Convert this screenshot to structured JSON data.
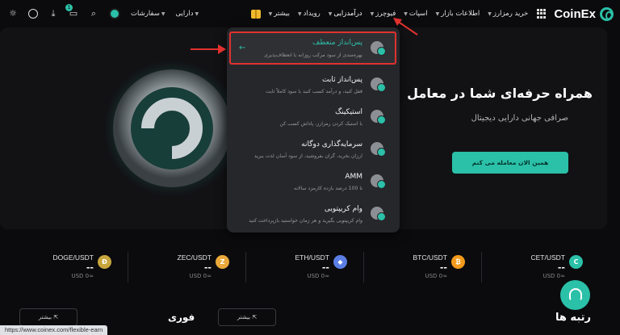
{
  "nav": {
    "brand": "CoinEx",
    "items": [
      {
        "label": "خرید رمزارز",
        "caret": true
      },
      {
        "label": "اطلاعات بازار",
        "caret": true
      },
      {
        "label": "اسپات",
        "caret": true
      },
      {
        "label": "فیوچرز",
        "caret": true
      },
      {
        "label": "درآمدزایی",
        "caret": true
      },
      {
        "label": "رویداد",
        "caret": true
      },
      {
        "label": "بیشتر",
        "caret": true
      }
    ],
    "assets": "دارایی",
    "orders": "سفارشات",
    "notification_count": "1"
  },
  "hero": {
    "title": "همراه حرفه‌ای شما در معامل",
    "subtitle": "صرافی جهانی دارایی دیجیتال",
    "cta": "همین الان معامله می کنم"
  },
  "dropdown": {
    "items": [
      {
        "title": "پس‌انداز منعطف",
        "desc": "بهره‌مندی از سود مرکب روزانه با انعطاف‌پذیری",
        "highlighted": true
      },
      {
        "title": "پس‌انداز ثابت",
        "desc": "قفل کنید، و درآمد کسب کنید با سود کاملاً ثابت"
      },
      {
        "title": "استیکینگ",
        "desc": "با استیک کردن رمزارز، پاداش کسب کن"
      },
      {
        "title": "سرمایه‌گذاری دوگانه",
        "desc": "ارزان بخرید، گران بفروشید، از سود آسان لذت ببرید"
      },
      {
        "title": "AMM",
        "desc": "تا 100 درصد بازده کارمزد سالانه"
      },
      {
        "title": "وام کریپتویی",
        "desc": "وام کریپتویی بگیرید و هر زمان خواستید بازپرداخت کنید"
      }
    ]
  },
  "tickers": [
    {
      "pair": "DOGE/USDT",
      "price": "--",
      "usd": "USD 0≈",
      "coin": "Ð",
      "color": "#c8a63d"
    },
    {
      "pair": "ZEC/USDT",
      "price": "--",
      "usd": "USD 0≈",
      "coin": "Z",
      "color": "#e8a93a"
    },
    {
      "pair": "ETH/USDT",
      "price": "--",
      "usd": "USD 0≈",
      "coin": "◆",
      "color": "#5b7ee5"
    },
    {
      "pair": "BTC/USDT",
      "price": "--",
      "usd": "USD 0≈",
      "coin": "₿",
      "color": "#f39a1c"
    },
    {
      "pair": "CET/USDT",
      "price": "--",
      "usd": "USD 0≈",
      "coin": "C",
      "color": "#2bc0a8"
    }
  ],
  "bottom": {
    "ranking_title": "رتبه ها",
    "instant_title": "فوری",
    "more_label": "بیشتر",
    "more_label_2": "بیشتر"
  },
  "status_url": "https://www.coinex.com/flexible-earn"
}
